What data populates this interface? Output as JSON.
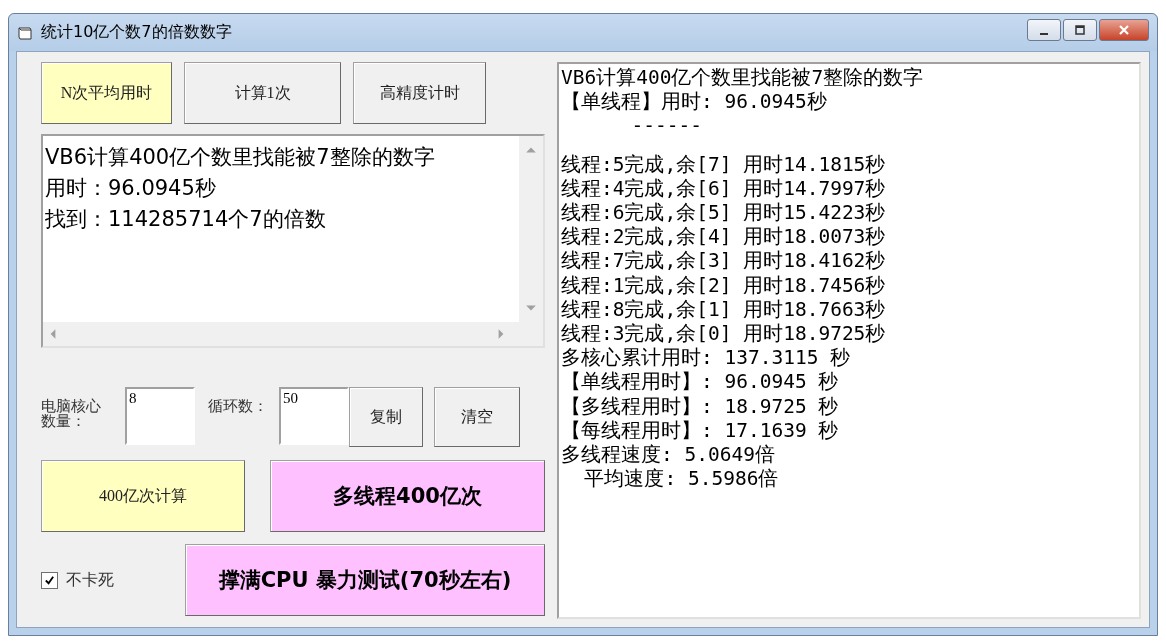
{
  "window": {
    "title": "统计10亿个数7的倍数数字"
  },
  "top_buttons": [
    {
      "label": "N次平均用时",
      "color": "#ffffc0"
    },
    {
      "label": "计算1次",
      "color": "#f0f0f0"
    },
    {
      "label": "高精度计时",
      "color": "#f0f0f0"
    }
  ],
  "result_box": {
    "lines": [
      "VB6计算400亿个数里找能被7整除的数字",
      "用时：96.0945秒",
      "找到：114285714个7的倍数"
    ]
  },
  "core_count": {
    "label": "电脑核心数量：",
    "value": "8"
  },
  "loop_count": {
    "label": "循环数：",
    "value": "50"
  },
  "copy_button": "复制",
  "clear_button": "清空",
  "single_button": {
    "label": "400亿次计算",
    "color": "#ffffc0"
  },
  "multi_button": {
    "label": "多线程400亿次",
    "color": "#ffc0ff"
  },
  "no_freeze": {
    "label": "不卡死",
    "checked": true
  },
  "stress_button": {
    "label": "撑满CPU 暴力测试(70秒左右)",
    "color": "#ffc0ff"
  },
  "log": {
    "lines": [
      "VB6计算400亿个数里找能被7整除的数字",
      "【单线程】用时: 96.0945秒",
      "      ------",
      "线程:5完成,余[7] 用时14.1815秒",
      "线程:4完成,余[6] 用时14.7997秒",
      "线程:6完成,余[5] 用时15.4223秒",
      "线程:2完成,余[4] 用时18.0073秒",
      "线程:7完成,余[3] 用时18.4162秒",
      "线程:1完成,余[2] 用时18.7456秒",
      "线程:8完成,余[1] 用时18.7663秒",
      "线程:3完成,余[0] 用时18.9725秒",
      "多核心累计用时: 137.3115 秒",
      "【单线程用时】: 96.0945 秒",
      "【多线程用时】: 18.9725 秒",
      "【每线程用时】: 17.1639 秒",
      "多线程速度: 5.0649倍",
      "  平均速度: 5.5986倍"
    ]
  }
}
